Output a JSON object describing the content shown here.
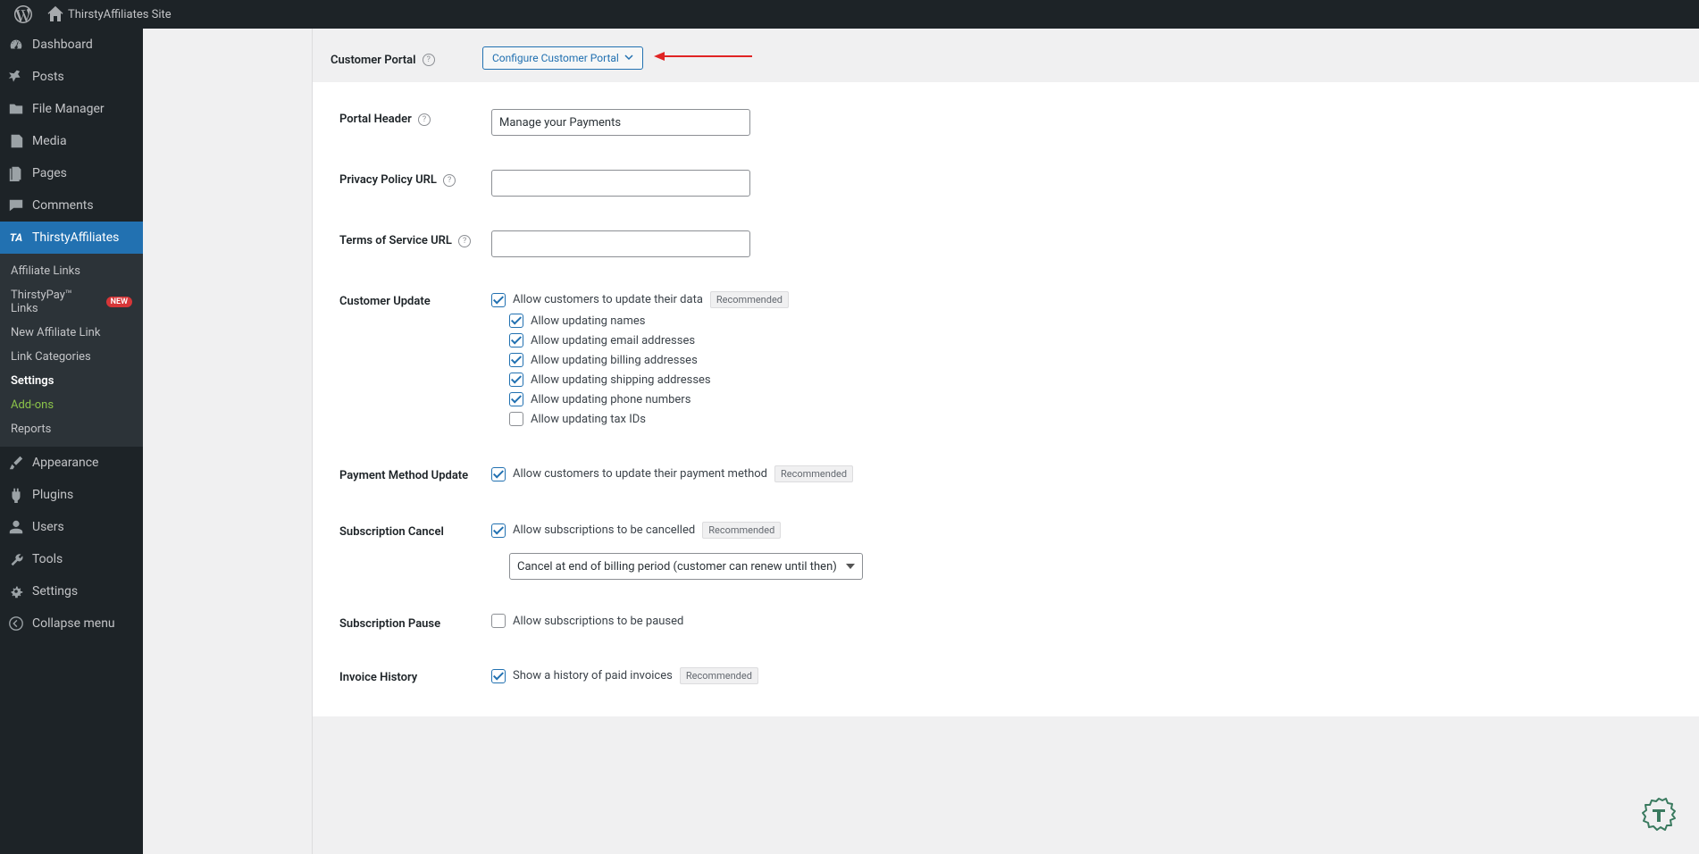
{
  "adminbar": {
    "site_name": "ThirstyAffiliates Site"
  },
  "sidebar": {
    "items": [
      {
        "label": "Dashboard",
        "icon": "dashboard"
      },
      {
        "label": "Posts",
        "icon": "pin"
      },
      {
        "label": "File Manager",
        "icon": "folder"
      },
      {
        "label": "Media",
        "icon": "media"
      },
      {
        "label": "Pages",
        "icon": "pages"
      },
      {
        "label": "Comments",
        "icon": "comments"
      },
      {
        "label": "ThirstyAffiliates",
        "icon": "ta",
        "active": true
      },
      {
        "label": "Appearance",
        "icon": "brush"
      },
      {
        "label": "Plugins",
        "icon": "plugin"
      },
      {
        "label": "Users",
        "icon": "users"
      },
      {
        "label": "Tools",
        "icon": "tools"
      },
      {
        "label": "Settings",
        "icon": "settings"
      },
      {
        "label": "Collapse menu",
        "icon": "collapse"
      }
    ],
    "submenu": [
      {
        "label": "Affiliate Links"
      },
      {
        "label": "ThirstyPay™ Links",
        "badge": "NEW"
      },
      {
        "label": "New Affiliate Link"
      },
      {
        "label": "Link Categories"
      },
      {
        "label": "Settings",
        "current": true
      },
      {
        "label": "Add-ons",
        "addons": true
      },
      {
        "label": "Reports"
      }
    ]
  },
  "header": {
    "label": "Customer Portal",
    "button": "Configure Customer Portal"
  },
  "form": {
    "portal_header": {
      "label": "Portal Header",
      "value": "Manage your Payments"
    },
    "privacy_url": {
      "label": "Privacy Policy URL",
      "value": ""
    },
    "tos_url": {
      "label": "Terms of Service URL",
      "value": ""
    },
    "customer_update": {
      "label": "Customer Update",
      "main": {
        "label": "Allow customers to update their data",
        "checked": true,
        "recommended": "Recommended"
      },
      "children": [
        {
          "label": "Allow updating names",
          "checked": true
        },
        {
          "label": "Allow updating email addresses",
          "checked": true
        },
        {
          "label": "Allow updating billing addresses",
          "checked": true
        },
        {
          "label": "Allow updating shipping addresses",
          "checked": true
        },
        {
          "label": "Allow updating phone numbers",
          "checked": true
        },
        {
          "label": "Allow updating tax IDs",
          "checked": false
        }
      ]
    },
    "payment_update": {
      "label": "Payment Method Update",
      "main": {
        "label": "Allow customers to update their payment method",
        "checked": true,
        "recommended": "Recommended"
      }
    },
    "sub_cancel": {
      "label": "Subscription Cancel",
      "main": {
        "label": "Allow subscriptions to be cancelled",
        "checked": true,
        "recommended": "Recommended"
      },
      "select": "Cancel at end of billing period (customer can renew until then)"
    },
    "sub_pause": {
      "label": "Subscription Pause",
      "main": {
        "label": "Allow subscriptions to be paused",
        "checked": false
      }
    },
    "invoice": {
      "label": "Invoice History",
      "main": {
        "label": "Show a history of paid invoices",
        "checked": true,
        "recommended": "Recommended"
      }
    }
  }
}
